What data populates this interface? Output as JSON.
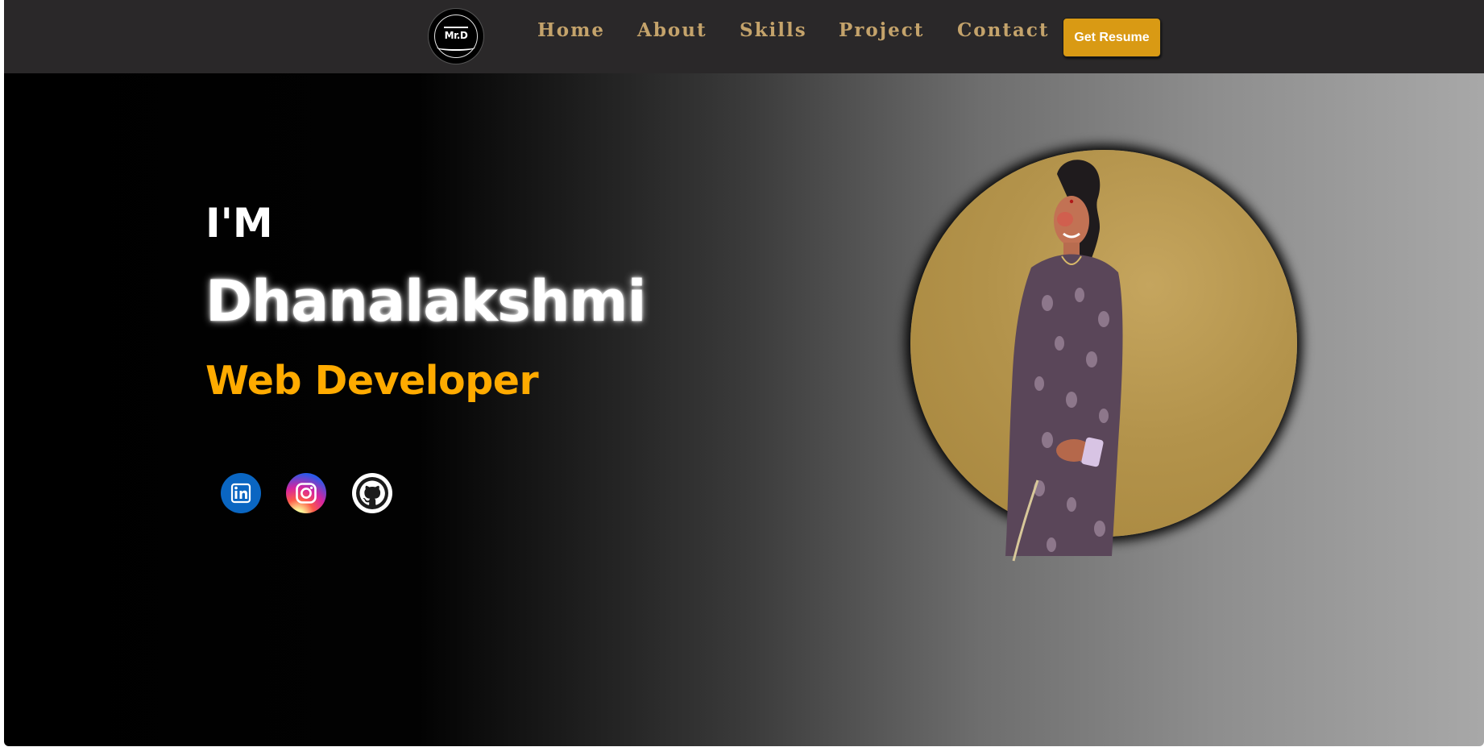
{
  "nav": {
    "logo_text": "Mr.D",
    "links": [
      "Home",
      "About",
      "Skills",
      "Project",
      "Contact"
    ],
    "resume_button": "Get Resume"
  },
  "hero": {
    "intro": "I'M",
    "name": "Dhanalakshmi",
    "role": "Web Developer"
  },
  "social": [
    {
      "icon": "linkedin-icon",
      "color": "#0a66c2"
    },
    {
      "icon": "instagram-icon",
      "color": "#d6249f"
    },
    {
      "icon": "github-icon",
      "color": "#ffffff"
    }
  ],
  "colors": {
    "navbar": "#2a2829",
    "nav_link": "#c4a36b",
    "accent": "#ffab00",
    "button": "#d99a14",
    "portrait_bg": "#b3934b"
  }
}
